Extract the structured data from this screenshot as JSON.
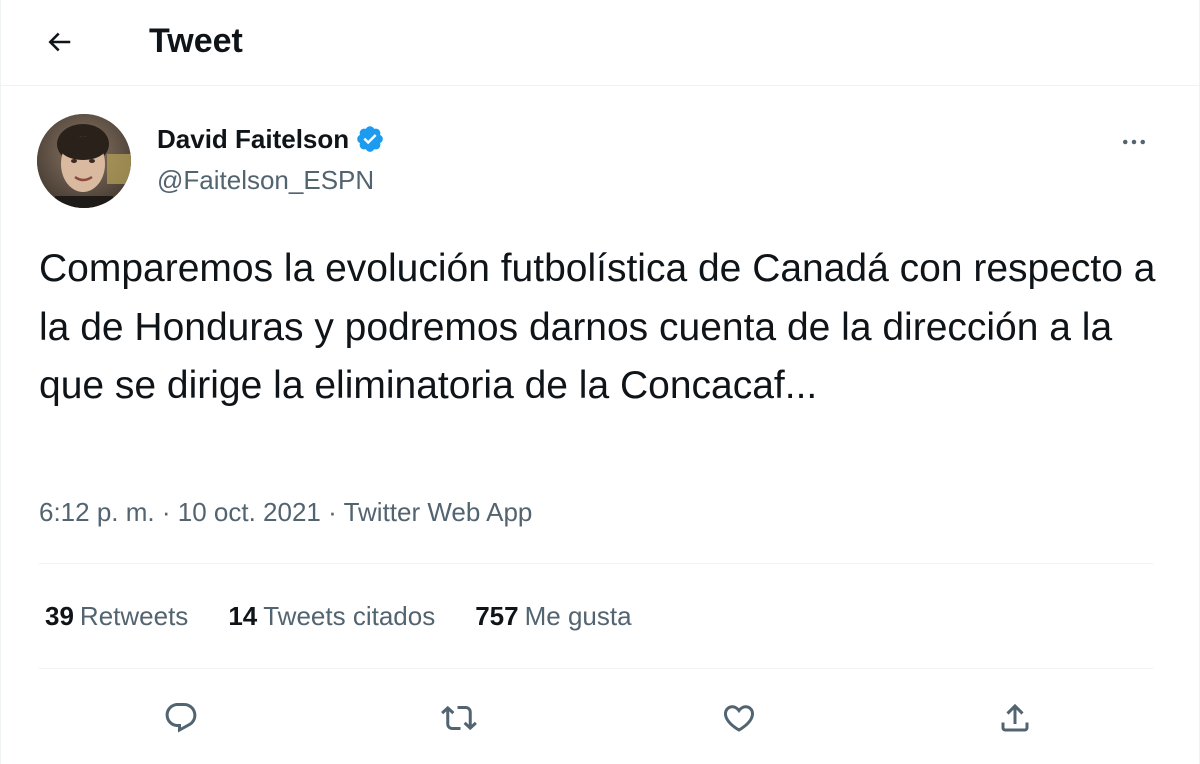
{
  "header": {
    "title": "Tweet",
    "back_icon": "arrow-left-icon"
  },
  "author": {
    "name": "David Faitelson",
    "handle": "@Faitelson_ESPN",
    "verified": true,
    "verified_color": "#1d9bf0"
  },
  "tweet": {
    "text": "Comparemos la evolución futbolística de Canadá con respecto a la de Honduras y podremos darnos cuenta de la dirección a la que se dirige la eliminatoria de la Concacaf...",
    "time": "6:12 p. m.",
    "date": "10 oct. 2021",
    "source": "Twitter Web App",
    "separator": "·"
  },
  "stats": [
    {
      "count": "39",
      "label": "Retweets"
    },
    {
      "count": "14",
      "label": "Tweets citados"
    },
    {
      "count": "757",
      "label": "Me gusta"
    }
  ],
  "actions": [
    {
      "name": "reply",
      "icon": "reply-icon"
    },
    {
      "name": "retweet",
      "icon": "retweet-icon"
    },
    {
      "name": "like",
      "icon": "heart-icon"
    },
    {
      "name": "share",
      "icon": "share-icon"
    }
  ],
  "colors": {
    "text_primary": "#0f1419",
    "text_secondary": "#536471",
    "divider": "#eff3f4",
    "accent": "#1d9bf0"
  }
}
